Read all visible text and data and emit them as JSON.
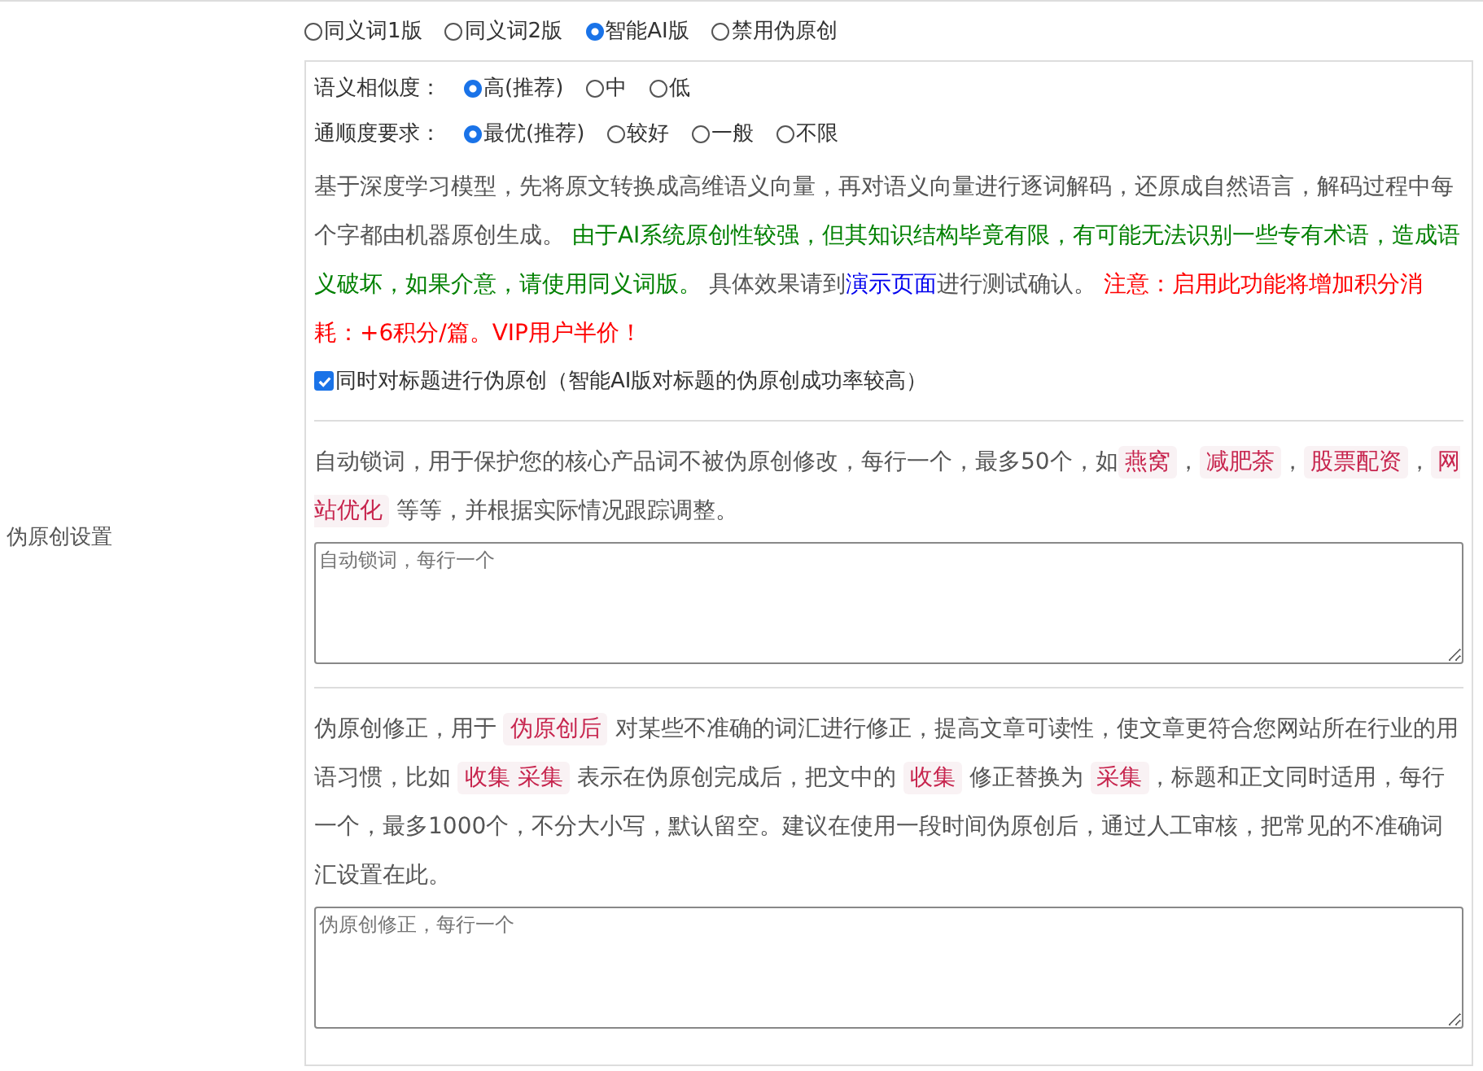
{
  "mode_options": [
    {
      "label": "同义词1版",
      "selected": false
    },
    {
      "label": "同义词2版",
      "selected": false
    },
    {
      "label": "智能AI版",
      "selected": true
    },
    {
      "label": "禁用伪原创",
      "selected": false
    }
  ],
  "section_label": "伪原创设置",
  "similarity": {
    "label": "语义相似度：",
    "options": [
      {
        "label": "高(推荐)",
        "selected": true
      },
      {
        "label": "中",
        "selected": false
      },
      {
        "label": "低",
        "selected": false
      }
    ]
  },
  "fluency": {
    "label": "通顺度要求：",
    "options": [
      {
        "label": "最优(推荐)",
        "selected": true
      },
      {
        "label": "较好",
        "selected": false
      },
      {
        "label": "一般",
        "selected": false
      },
      {
        "label": "不限",
        "selected": false
      }
    ]
  },
  "description": [
    {
      "kind": "text",
      "text": "基于深度学习模型，先将原文转换成高维语义向量，再对语义向量进行逐词解码，还原成自然语言，解码过程中每个字都由机器原创生成。 "
    },
    {
      "kind": "success",
      "text": "由于AI系统原创性较强，但其知识结构毕竟有限，有可能无法识别一些专有术语，造成语义破坏，如果介意，请使用同义词版。"
    },
    {
      "kind": "text",
      "text": " 具体效果请到"
    },
    {
      "kind": "link",
      "text": "演示页面"
    },
    {
      "kind": "text",
      "text": "进行测试确认。 "
    },
    {
      "kind": "warning",
      "text": "注意：启用此功能将增加积分消耗：+6积分/篇。VIP用户半价！"
    }
  ],
  "title_option": {
    "label": "同时对标题进行伪原创（智能AI版对标题的伪原创成功率较高）",
    "checked": true
  },
  "lock_words": {
    "description": [
      {
        "kind": "text",
        "text": "自动锁词，用于保护您的核心产品词不被伪原创修改，每行一个，最多50个，如"
      },
      {
        "kind": "code",
        "text": "燕窝"
      },
      {
        "kind": "text",
        "text": "，"
      },
      {
        "kind": "code",
        "text": "减肥茶"
      },
      {
        "kind": "text",
        "text": "，"
      },
      {
        "kind": "code",
        "text": "股票配资"
      },
      {
        "kind": "text",
        "text": "，"
      },
      {
        "kind": "code",
        "text": "网站优化"
      },
      {
        "kind": "text",
        "text": " 等等，并根据实际情况跟踪调整。"
      }
    ],
    "placeholder": "自动锁词，每行一个"
  },
  "corrections_x": {
    "description": [
      {
        "kind": "text",
        "text": "伪原创修正，用于 "
      },
      {
        "kind": "code",
        "text": "伪原创后"
      },
      {
        "kind": "text",
        "text": " 对某些不准确的词汇进行修正，提高文章可读性，使文章更符合您网站所在行业的用语习惯，比如 "
      },
      {
        "kind": "code",
        "text": "收集 采集"
      },
      {
        "kind": "text",
        "text": " 表示在伪原创完成后，把文中的 "
      },
      {
        "kind": "code",
        "text": "收集"
      },
      {
        "kind": "text",
        "text": " 修正替换为 "
      },
      {
        "kind": "code",
        "text": "采集"
      },
      {
        "kind": "text",
        "text": "，标题和正文同时适用，每行一个，最多1000个，不分大小写，默认留空。建议在使用一段时间伪原创后，通过人工审核，把常见的不准确词汇设置在此。"
      }
    ],
    "placeholder": "伪原创修正，每行一个"
  }
}
